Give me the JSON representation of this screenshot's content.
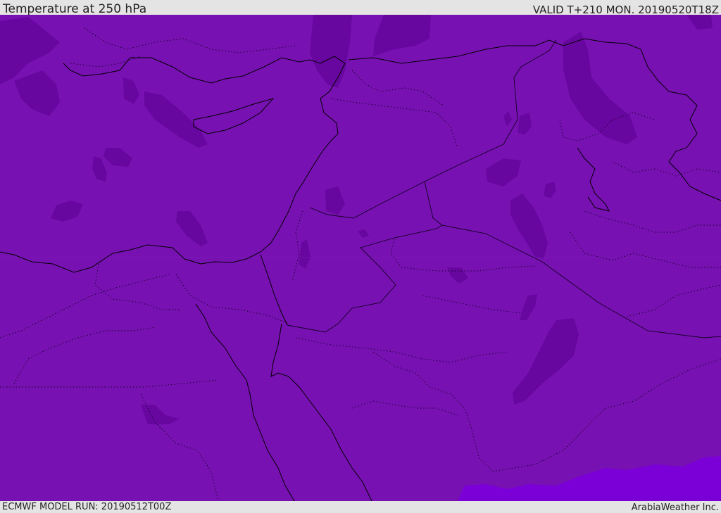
{
  "header": {
    "title": "Temperature at 250 hPa",
    "valid_time": "VALID T+210 MON. 20190520T18Z"
  },
  "footer": {
    "model_run": "ECMWF MODEL RUN: 20190512T00Z",
    "credit": "ArabiaWeather Inc."
  },
  "map": {
    "fill_colors": {
      "base": "#7811b2",
      "cold_patch": "#6806a0",
      "warm_patch": "#7b00d8",
      "coastline": "#000000",
      "borders": "#1a0030"
    }
  }
}
